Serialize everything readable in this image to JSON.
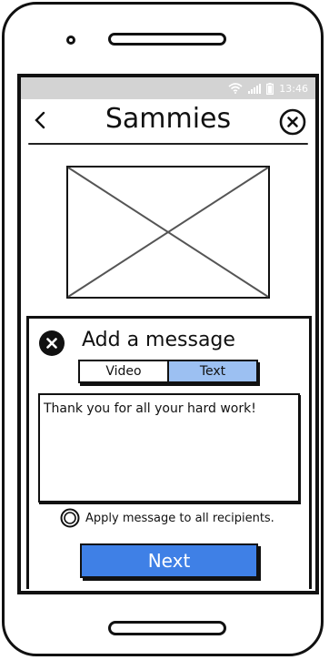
{
  "status_bar": {
    "time": "13:46"
  },
  "header": {
    "title": "Sammies"
  },
  "sheet": {
    "title": "Add a message",
    "tabs": [
      {
        "label": "Video",
        "active": false
      },
      {
        "label": "Text",
        "active": true
      }
    ],
    "message_text": "Thank you for all your hard work!",
    "apply_all_label": "Apply message to all recipients.",
    "next_label": "Next"
  },
  "colors": {
    "status_bar_bg": "#d3d3d3",
    "tab_active_bg": "#9cc0f2",
    "next_button_bg": "#3f80e6"
  }
}
